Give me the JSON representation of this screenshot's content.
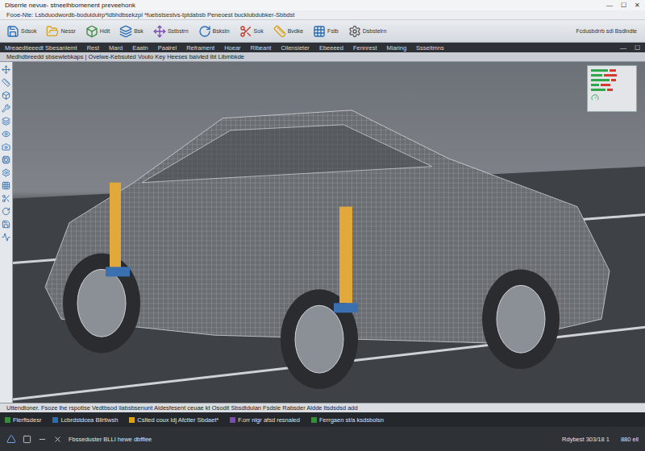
{
  "window": {
    "title": "Dlserrle nevue- stneelhbomenent preveehonk",
    "controls": [
      "—",
      "☐",
      "✕"
    ]
  },
  "address": "Fooe-Nte: Lsbduodwordb-boduidulrp*ldbhdbsekzpl *fuebstsestvs-tptdabsb Peneoest bucklubdubker-Sbbdst",
  "toolbar": {
    "items": [
      {
        "label": "Sdsok"
      },
      {
        "label": "Nessr"
      },
      {
        "label": "Hdlt"
      },
      {
        "label": "Bsk"
      },
      {
        "label": "Sstbstrn"
      },
      {
        "label": "Bskstn"
      },
      {
        "label": "Sok"
      },
      {
        "label": "Bvdke"
      },
      {
        "label": "Fstb"
      },
      {
        "label": "Dsbstelrn"
      }
    ],
    "right_label": "Fcdusbdrrb sdl Bsdlndte"
  },
  "menu": {
    "items": [
      "Mreaedtieeedt Sbesanlemt",
      "Rest",
      "Mard",
      "Eaatn",
      "Paalrel",
      "Reframent",
      "Hoear",
      "Rlbeant",
      "Cilensieter",
      "Ebeeeed",
      "Fennrest",
      "Miaring",
      "Ssseitmns"
    ],
    "controls": [
      "—",
      "☐"
    ]
  },
  "document": {
    "title": "Medhdbreedd sbsewlebkaps | Ovelwe-Kebsuted Vouto Key Heeses baivled ibt Libmbkde"
  },
  "chart": {
    "series": [
      {
        "values": [
          80,
          55,
          90,
          40,
          70
        ],
        "color": "#2ea84a"
      },
      {
        "values": [
          30,
          60,
          20,
          45,
          25
        ],
        "color": "#d23b2f"
      }
    ]
  },
  "status_text": "Uttendtoner. Fsoze lhe rspotise Vedtbsod ilabsbsenunt Aldesfesent ceuae kt Osodit Sbsdtdulan Fsdsle Rabsder Aldde ltsdsdsd add",
  "taskbar": {
    "items": [
      "Flerftsdesr",
      "Lcbrdstdcea Bllrtiwsh",
      "Cslted coux ldj Afctter Sbdaet*",
      "F.orr nlgr afsd resnaled",
      "Ferrgaen st/a ksdsbolsn"
    ]
  },
  "bottom": {
    "left": "Fbsseduster BLLI hewe dbfflee",
    "right": [
      "Rdybest 303/18 1",
      "880 ell"
    ]
  }
}
